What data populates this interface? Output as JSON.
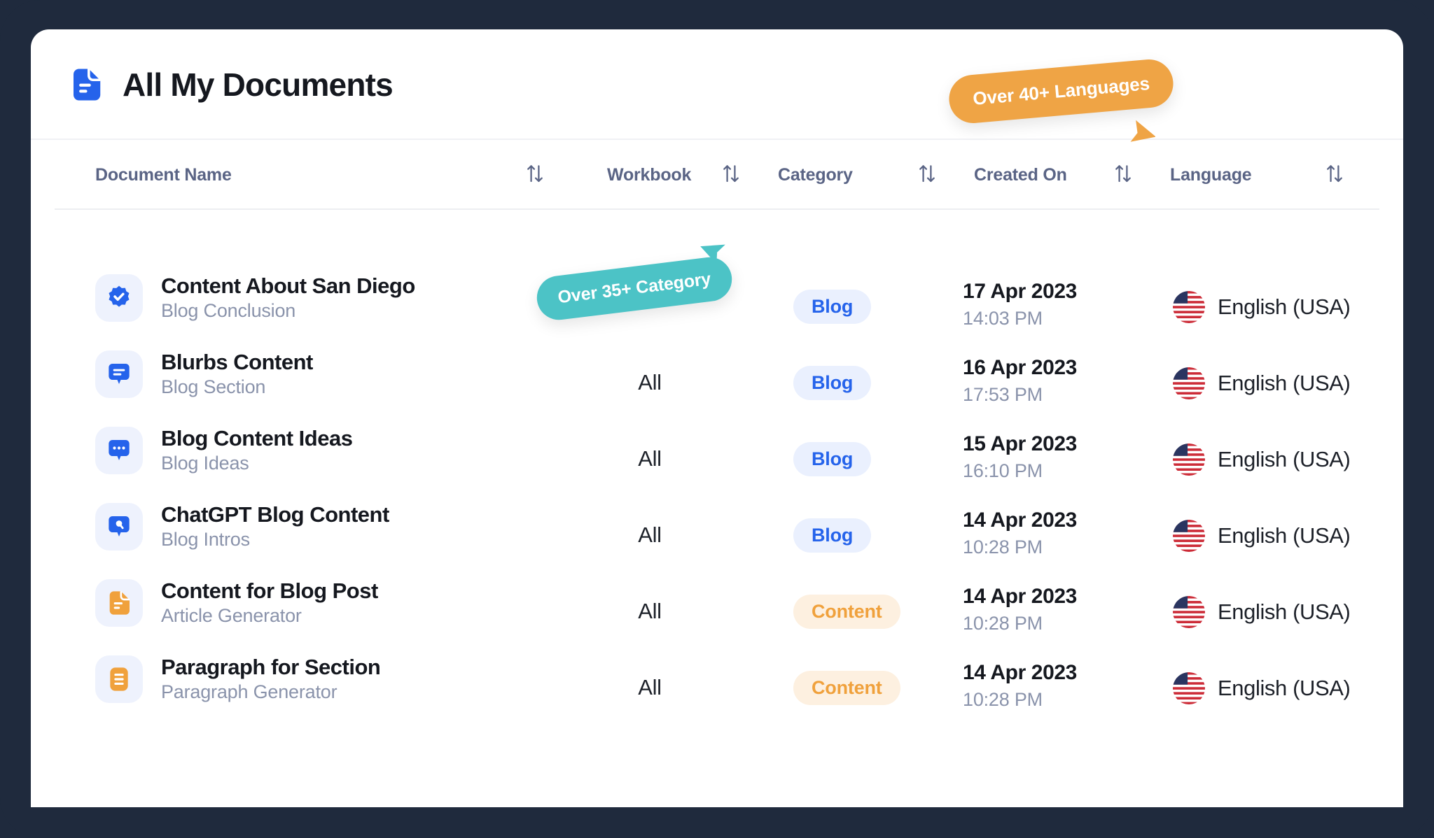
{
  "header": {
    "title": "All My Documents",
    "icon": "document-icon"
  },
  "tooltips": {
    "languages": "Over 40+ Languages",
    "category": "Over 35+ Category",
    "languages_color": "#efa445",
    "category_color": "#4cc3c6"
  },
  "table": {
    "columns": [
      {
        "label": "Document Name",
        "sort_icon": "sort-icon"
      },
      {
        "label": "Workbook",
        "sort_icon": "sort-icon"
      },
      {
        "label": "Category",
        "sort_icon": "sort-icon"
      },
      {
        "label": "Created On",
        "sort_icon": "sort-icon"
      },
      {
        "label": "Language",
        "sort_icon": "sort-icon"
      }
    ],
    "rows": [
      {
        "icon": "badge-check-icon",
        "icon_color": "#2563eb",
        "name": "Content About San Diego",
        "subtitle": "Blog Conclusion",
        "workbook": "",
        "category": "Blog",
        "category_style": "blog",
        "date": "17 Apr 2023",
        "time": "14:03 PM",
        "language": "English (USA)",
        "flag": "us-flag-icon"
      },
      {
        "icon": "chat-lines-icon",
        "icon_color": "#2563eb",
        "name": "Blurbs Content",
        "subtitle": "Blog Section",
        "workbook": "All",
        "category": "Blog",
        "category_style": "blog",
        "date": "16 Apr 2023",
        "time": "17:53 PM",
        "language": "English (USA)",
        "flag": "us-flag-icon"
      },
      {
        "icon": "chat-dots-icon",
        "icon_color": "#2563eb",
        "name": "Blog Content Ideas",
        "subtitle": "Blog Ideas",
        "workbook": "All",
        "category": "Blog",
        "category_style": "blog",
        "date": "15 Apr 2023",
        "time": "16:10 PM",
        "language": "English (USA)",
        "flag": "us-flag-icon"
      },
      {
        "icon": "chat-circle-icon",
        "icon_color": "#2563eb",
        "name": "ChatGPT Blog Content",
        "subtitle": "Blog Intros",
        "workbook": "All",
        "category": "Blog",
        "category_style": "blog",
        "date": "14 Apr 2023",
        "time": "10:28 PM",
        "language": "English (USA)",
        "flag": "us-flag-icon"
      },
      {
        "icon": "document-fold-icon",
        "icon_color": "#f0a13c",
        "name": "Content for Blog Post",
        "subtitle": "Article Generator",
        "workbook": "All",
        "category": "Content",
        "category_style": "content",
        "date": "14 Apr 2023",
        "time": "10:28 PM",
        "language": "English (USA)",
        "flag": "us-flag-icon"
      },
      {
        "icon": "document-lines-icon",
        "icon_color": "#f0a13c",
        "name": "Paragraph for Section",
        "subtitle": "Paragraph Generator",
        "workbook": "All",
        "category": "Content",
        "category_style": "content",
        "date": "14 Apr 2023",
        "time": "10:28 PM",
        "language": "English (USA)",
        "flag": "us-flag-icon"
      }
    ]
  },
  "colors": {
    "page_background": "#1f2a3d",
    "card_background": "#ffffff",
    "accent_blue": "#2563eb",
    "accent_orange": "#f0a13c",
    "accent_teal": "#4cc3c6",
    "muted_text": "#8a93ab",
    "header_text": "#5a6485"
  }
}
